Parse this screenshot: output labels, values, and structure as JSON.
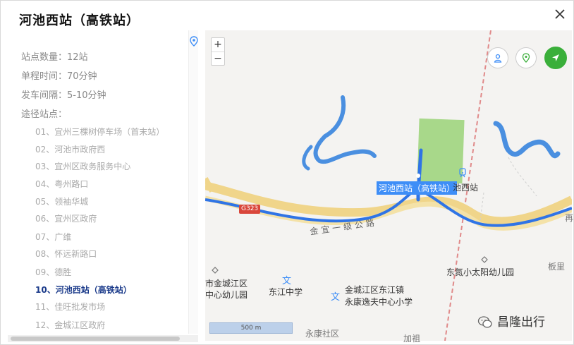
{
  "dialog": {
    "title": "河池西站（高铁站）"
  },
  "info": {
    "stop_count": "站点数量：12站",
    "trip_time": "单程时间：70分钟",
    "interval": "发车间隔：5-10分钟",
    "via": "途径站点："
  },
  "stops": [
    "01、宜州三棵树停车场（首末站）",
    "02、河池市政府西",
    "03、宜州区政务服务中心",
    "04、粤州路口",
    "05、领袖华城",
    "06、宜州区政府",
    "07、广维",
    "08、怀远新路口",
    "09、德胜",
    "10、河池西站（高铁站）",
    "11、佳旺批发市场",
    "12、金城江区政府"
  ],
  "active_stop_index": 9,
  "map": {
    "zoom_in": "+",
    "zoom_out": "−",
    "station_label": "河池西站（高铁站）",
    "station_poi": "池西站",
    "road_code": "G323",
    "road_name": "金宜一级公路",
    "pois": {
      "kindergarten_a_1": "市金城江区",
      "kindergarten_a_2": "中心幼儿园",
      "school_a": "东江中学",
      "school_b_1": "金城江区东江镇",
      "school_b_2": "永康逸夫中心小学",
      "kindergarten_b": "东氮小太阳幼儿园",
      "village": "板里",
      "district": "永康社区",
      "partial": "加祖",
      "edge_char": "再"
    },
    "scale": "500 m"
  },
  "watermark": "昌隆出行",
  "colors": {
    "route": "#2f74e6",
    "active_stop": "#1a3a8a",
    "label_bg": "#3e8ef7",
    "green_button": "#3aaf3a",
    "water": "#4a8fe0",
    "railway": "#e08a8a",
    "green_area": "#a8d88a"
  }
}
